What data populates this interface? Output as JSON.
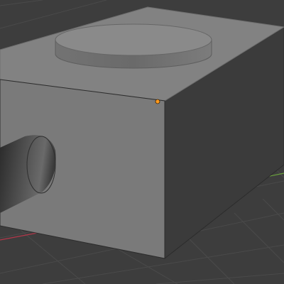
{
  "viewport": {
    "background_color": "#3d3d3d",
    "grid_line_color": "#4a4a4a",
    "x_axis_color": "#b3374a",
    "y_axis_color": "#6aa23c"
  },
  "objects": {
    "box": {
      "top_face_color": "#828282",
      "front_face_color": "#7a7a7a",
      "side_face_color": "#3b3b3b",
      "edge_color": "#2c2c2c"
    },
    "cylinder_top": {
      "top_color": "#8a8a8a",
      "side_color": "#6c6c6c"
    },
    "cylinder_front": {
      "color": "#4e4e4e",
      "cap_color": "#5a5a5a"
    },
    "origin_point": {
      "color": "#ff9a1f"
    }
  }
}
